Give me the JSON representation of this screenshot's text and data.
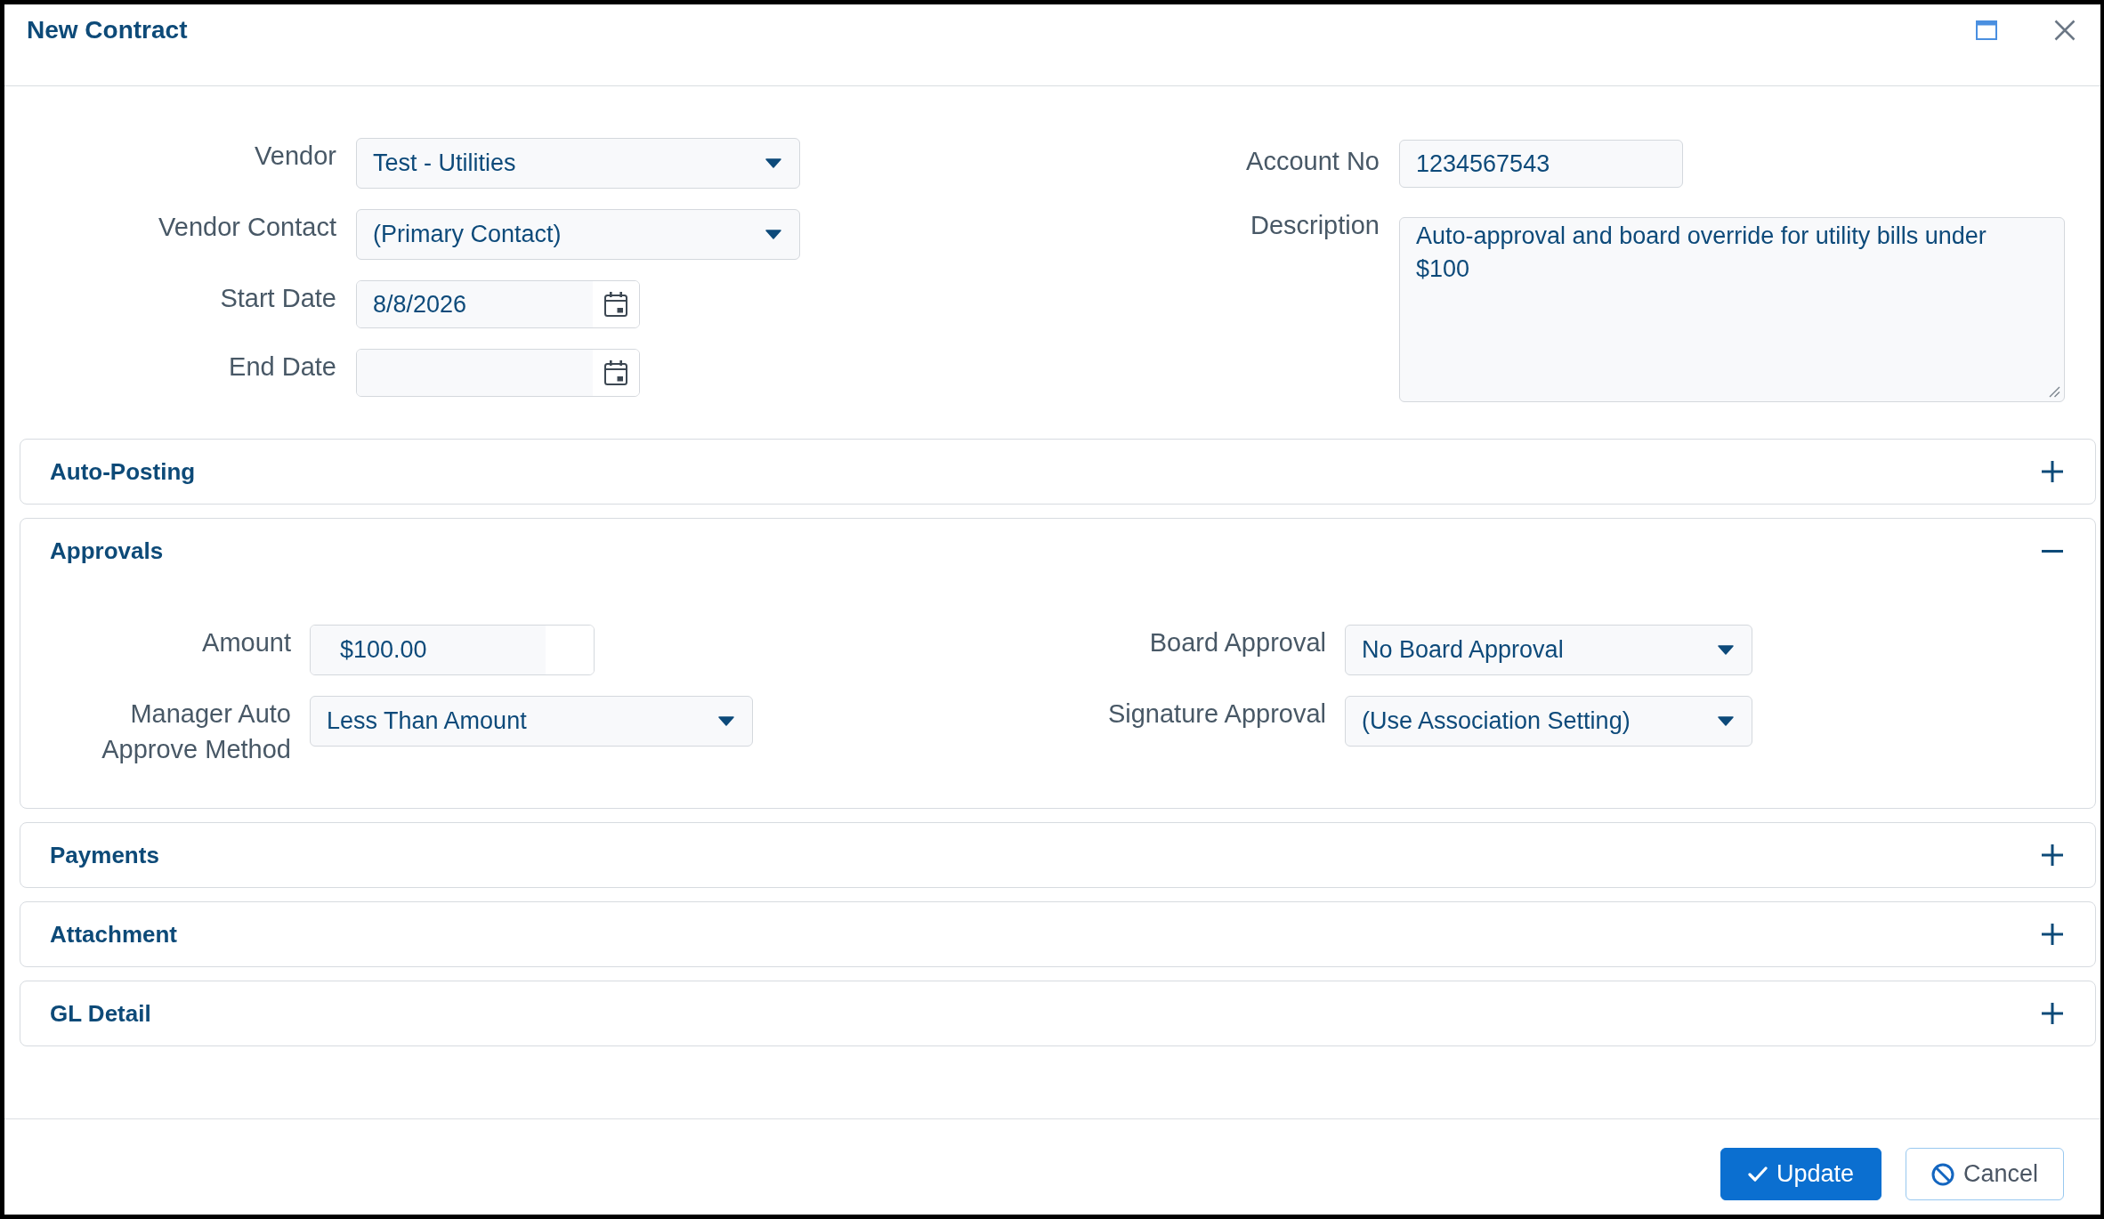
{
  "window": {
    "title": "New Contract"
  },
  "form": {
    "left_fields": [
      {
        "label": "Vendor",
        "kind": "select",
        "value": "Test - Utilities"
      },
      {
        "label": "Vendor Contact",
        "kind": "select",
        "value": "(Primary Contact)"
      },
      {
        "label": "Start Date",
        "kind": "date",
        "value": "8/8/2026"
      },
      {
        "label": "End Date",
        "kind": "date"
      }
    ],
    "right_fields": [
      {
        "label": "Account No",
        "kind": "text",
        "value": "1234567543"
      },
      {
        "label": "Description",
        "kind": "textarea",
        "value": "Auto-approval and board override for utility bills under $100"
      }
    ]
  },
  "sections": [
    {
      "title": "Auto-Posting",
      "expanded": false
    },
    {
      "title": "Approvals",
      "expanded": true,
      "left_fields": [
        {
          "label": "Amount",
          "kind": "currency",
          "value": "$100.00"
        },
        {
          "label": "Manager Auto Approve Method",
          "kind": "select",
          "value": "Less Than Amount"
        }
      ],
      "right_fields": [
        {
          "label": "Board Approval",
          "kind": "select",
          "value": "No Board Approval"
        },
        {
          "label": "Signature Approval",
          "kind": "select",
          "value": "(Use Association Setting)"
        }
      ]
    },
    {
      "title": "Payments",
      "expanded": false
    },
    {
      "title": "Attachment",
      "expanded": false
    },
    {
      "title": "GL Detail",
      "expanded": false
    }
  ],
  "buttons": [
    {
      "label": "Update",
      "kind": "primary"
    },
    {
      "label": "Cancel",
      "kind": "secondary"
    }
  ]
}
